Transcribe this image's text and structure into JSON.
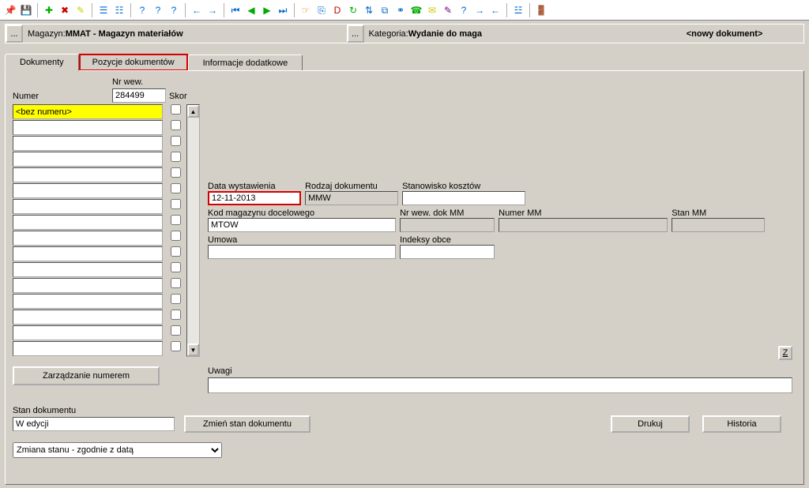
{
  "toolbar": {
    "icons": [
      {
        "name": "pin-icon",
        "glyph": "📌",
        "cls": "yellow"
      },
      {
        "name": "save-icon",
        "glyph": "💾",
        "cls": "yellow"
      },
      {
        "sep": true
      },
      {
        "name": "add-icon",
        "glyph": "✚",
        "cls": "green"
      },
      {
        "name": "remove-icon",
        "glyph": "✖",
        "cls": "red"
      },
      {
        "name": "edit-icon",
        "glyph": "✎",
        "cls": "yellow"
      },
      {
        "sep": true
      },
      {
        "name": "tree1-icon",
        "glyph": "☰",
        "cls": "blue"
      },
      {
        "name": "tree2-icon",
        "glyph": "☷",
        "cls": "blue"
      },
      {
        "sep": true
      },
      {
        "name": "help1-icon",
        "glyph": "?",
        "cls": "blue"
      },
      {
        "name": "help2-icon",
        "glyph": "?",
        "cls": "blue"
      },
      {
        "name": "help3-icon",
        "glyph": "?",
        "cls": "blue"
      },
      {
        "sep": true
      },
      {
        "name": "nav-back-icon",
        "glyph": "←",
        "cls": "blue"
      },
      {
        "name": "nav-fwd-icon",
        "glyph": "→",
        "cls": "blue"
      },
      {
        "sep": true
      },
      {
        "name": "first-icon",
        "glyph": "⏮",
        "cls": "blue"
      },
      {
        "name": "prev-icon",
        "glyph": "◀",
        "cls": "green"
      },
      {
        "name": "next-icon",
        "glyph": "▶",
        "cls": "green"
      },
      {
        "name": "last-icon",
        "glyph": "⏭",
        "cls": "blue"
      },
      {
        "sep": true
      },
      {
        "name": "hand-icon",
        "glyph": "☞",
        "cls": "orange"
      },
      {
        "name": "copy-icon",
        "glyph": "⎘",
        "cls": "blue"
      },
      {
        "name": "d-icon",
        "glyph": "D",
        "cls": "red"
      },
      {
        "name": "refresh-icon",
        "glyph": "↻",
        "cls": "green"
      },
      {
        "name": "sort-icon",
        "glyph": "⇅",
        "cls": "blue"
      },
      {
        "name": "misc1-icon",
        "glyph": "⧉",
        "cls": "blue"
      },
      {
        "name": "link-icon",
        "glyph": "⚭",
        "cls": "blue"
      },
      {
        "name": "phone-icon",
        "glyph": "☎",
        "cls": "green"
      },
      {
        "name": "mail-icon",
        "glyph": "✉",
        "cls": "yellow"
      },
      {
        "name": "wand-icon",
        "glyph": "✎",
        "cls": "purple"
      },
      {
        "name": "help4-icon",
        "glyph": "?",
        "cls": "blue"
      },
      {
        "name": "nav-fwd2-icon",
        "glyph": "→",
        "cls": "blue"
      },
      {
        "name": "nav-back2-icon",
        "glyph": "←",
        "cls": "blue"
      },
      {
        "sep": true
      },
      {
        "name": "tool-extra-icon",
        "glyph": "☳",
        "cls": "blue"
      },
      {
        "sep": true
      },
      {
        "name": "exit-icon",
        "glyph": "🚪",
        "cls": "blue"
      }
    ]
  },
  "header": {
    "dots": "...",
    "mag_label": "Magazyn: ",
    "mag_value": "MMAT - Magazyn materiałów",
    "kat_label": "Kategoria: ",
    "kat_value": "Wydanie do maga",
    "new_doc": "<nowy dokument>"
  },
  "tabs": {
    "documents": "Dokumenty",
    "positions": "Pozycje dokumentów",
    "extra": "Informacje dodatkowe"
  },
  "left": {
    "nrwew_label": "Nr wew.",
    "nrwew_value": "284499",
    "numer_label": "Numer",
    "skor_label": "Skor",
    "first_row": "<bez numeru>",
    "manage_btn": "Zarządzanie numerem"
  },
  "fields": {
    "data_wystawienia": {
      "label": "Data wystawienia",
      "value": "12-11-2013"
    },
    "rodzaj_dokumentu": {
      "label": "Rodzaj dokumentu",
      "value": "MMW"
    },
    "stanowisko_kosztow": {
      "label": "Stanowisko kosztów",
      "value": ""
    },
    "kod_magazynu": {
      "label": "Kod magazynu docelowego",
      "value": "MTOW"
    },
    "nr_wew_dok_mm": {
      "label": "Nr wew. dok MM",
      "value": ""
    },
    "numer_mm": {
      "label": "Numer MM",
      "value": ""
    },
    "stan_mm": {
      "label": "Stan MM",
      "value": ""
    },
    "umowa": {
      "label": "Umowa",
      "value": ""
    },
    "indeksy_obce": {
      "label": "Indeksy obce",
      "value": ""
    },
    "z_btn": "Z",
    "uwagi_label": "Uwagi",
    "uwagi_value": ""
  },
  "bottom": {
    "stan_label": "Stan dokumentu",
    "stan_value": "W edycji",
    "change_state_btn": "Zmień stan dokumentu",
    "state_combo": "Zmiana stanu - zgodnie z datą",
    "print_btn": "Drukuj",
    "hist_btn": "Historia"
  }
}
